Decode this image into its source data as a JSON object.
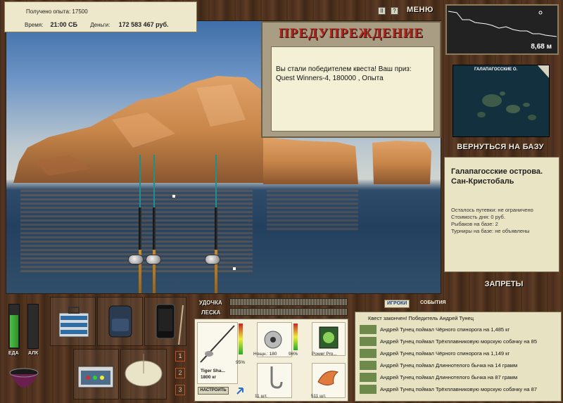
{
  "stats": {
    "xp_label": "Получено опыта:",
    "xp_value": "17500",
    "time_label": "Время:",
    "time_value": "21:00 СБ",
    "money_label": "Деньги:",
    "money_value": "172 583 467 руб."
  },
  "controls": {
    "pause_icon": "II",
    "info_icon": "?",
    "menu_label": "МЕНЮ"
  },
  "depth": {
    "value": "8,68 м"
  },
  "dialog": {
    "title": "ПРЕДУПРЕЖДЕНИЕ",
    "message": "Вы стали победителем квеста! Ваш приз: Quest Winners-4, 180000 , Опыта"
  },
  "map": {
    "title": "ГАЛАПАГОССКИЕ О."
  },
  "back_to_base": "ВЕРНУТЬСЯ НА БАЗУ",
  "location": {
    "title": "Галапагосские острова. Сан-Кристобаль",
    "lines": [
      "Осталось путевки: не ограничено",
      "Стоимость дня: 0 руб.",
      "Рыбаков на базе: 2",
      "Турниры на базе: не объявлены"
    ]
  },
  "bans_label": "ЗАПРЕТЫ",
  "meters": {
    "food_label": "ЕДА",
    "alc_label": "АЛК",
    "food_level": 0.74,
    "alc_level": 0
  },
  "tabs": [
    "1",
    "2",
    "3"
  ],
  "bars": {
    "rod_label": "УДОЧКА",
    "line_label": "ЛЕСКА"
  },
  "tackle": {
    "rod_name": "Tiger Sha...",
    "rod_weight": "1800 кг",
    "rod_pct": "95%",
    "reel_name": "Нощн.: 180",
    "reel_pct": "96%",
    "line_name": "Power Pro...",
    "hook_count": "11 шт.",
    "bait_count": "511 шт.",
    "setup_label": "НАСТРОИТЬ"
  },
  "log": {
    "tab_players": "ИГРОКИ",
    "tab_events": "СОБЫТИЯ",
    "header": "Квест закончен! Победитель Андрей Тунец",
    "entries": [
      "Андрей Тунец поймал Чёрного спинорога на 1,485 кг",
      "Андрей Тунец поймал Трёхплавниковую морскую собачку на 85",
      "Андрей Тунец поймал Чёрного спинорога на 1,149 кг",
      "Андрей Тунец поймал Длиннотелого бычка на 14 грамм",
      "Андрей Тунец поймал Длиннотелого бычка на 87 грамм",
      "Андрей Тунец поймал Трёхплавниковую морскую собачку на 87"
    ]
  }
}
